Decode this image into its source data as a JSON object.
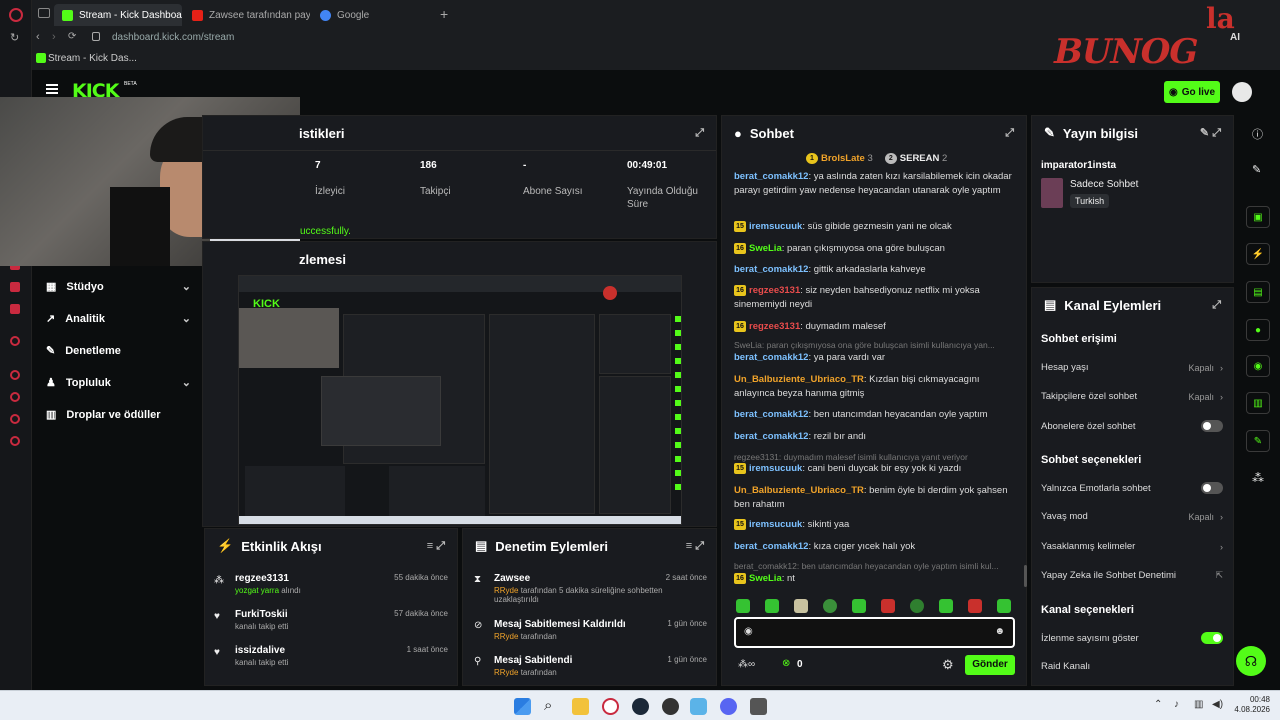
{
  "browser": {
    "tabs": [
      {
        "label": "Stream - Kick Dashboard"
      },
      {
        "label": "Zawsee tarafından paylaşı"
      },
      {
        "label": "Google"
      }
    ],
    "url": "dashboard.kick.com/stream",
    "bookmark": "Stream - Kick Das...",
    "ai_label": "AI"
  },
  "overlay": {
    "brand": "BUNOG",
    "brand_suffix": "la"
  },
  "header": {
    "logo": "KICK",
    "logo_sup": "BETA",
    "go_live": "Go live"
  },
  "stats": {
    "title": "istikleri",
    "items": [
      {
        "value": "7",
        "label": "İzleyici"
      },
      {
        "value": "186",
        "label": "Takipçi"
      },
      {
        "value": "-",
        "label": "Abone Sayısı"
      },
      {
        "value": "00:49:01",
        "label": "Yayında Olduğu Süre"
      }
    ],
    "notice": "uccessfully."
  },
  "preview": {
    "title": "zlemesi"
  },
  "sidebar": {
    "items": [
      {
        "label": "Stüdyo"
      },
      {
        "label": "Analitik"
      },
      {
        "label": "Denetleme"
      },
      {
        "label": "Topluluk"
      },
      {
        "label": "Droplar ve ödüller"
      }
    ]
  },
  "activity": {
    "title": "Etkinlik Akışı",
    "rows": [
      {
        "name": "regzee3131",
        "sub": "yozgat yarra",
        "sub2": "alındı",
        "time": "55 dakika önce"
      },
      {
        "name": "FurkiToskii",
        "sub": "kanalı takip etti",
        "sub2": "",
        "time": "57 dakika önce"
      },
      {
        "name": "issizdalive",
        "sub": "kanalı takip etti",
        "sub2": "",
        "time": "1 saat önce"
      }
    ]
  },
  "moderation": {
    "title": "Denetim Eylemleri",
    "rows": [
      {
        "name": "Zawsee",
        "by": "RRyde",
        "sub": "tarafından 5 dakika süreliğine sohbetten uzaklaştırıldı",
        "time": "2 saat önce"
      },
      {
        "name": "Mesaj Sabitlemesi Kaldırıldı",
        "by": "RRyde",
        "sub": "tarafından",
        "time": "1 gün önce"
      },
      {
        "name": "Mesaj Sabitlendi",
        "by": "RRyde",
        "sub": "tarafından",
        "time": "1 gün önce"
      }
    ]
  },
  "chat": {
    "title": "Sohbet",
    "leaders": [
      {
        "name": "BrolsLate",
        "count": "3",
        "rank": "1"
      },
      {
        "name": "SEREAN",
        "count": "2",
        "rank": "2"
      }
    ],
    "messages": [
      {
        "badge": "",
        "user": "berat_comakk12",
        "color": "l",
        "text": ": ya aslında zaten kızı karsilabilemek icin okadar parayı getirdim yaw nedense heyacandan utanarak oyle yaptım"
      },
      {
        "badge": "15",
        "user": "iremsucuuk",
        "color": "l",
        "text": ": süs gibide gezmesin yani ne olcak"
      },
      {
        "badge": "16",
        "user": "SweLia",
        "color": "g",
        "text": ": paran çıkışmıyosa ona göre buluşcan"
      },
      {
        "badge": "",
        "user": "berat_comakk12",
        "color": "l",
        "text": ": gittik arkadaslarla kahveye"
      },
      {
        "badge": "16",
        "user": "regzee3131",
        "color": "r",
        "text": ": siz neyden bahsediyonuz netflix mi yoksa sinememiydi neydi"
      },
      {
        "badge": "16",
        "user": "regzee3131",
        "color": "r",
        "text": ": duymadım malesef"
      },
      {
        "badge": "",
        "user": "",
        "color": "f",
        "text": "SweLia: paran çıkışmıyosa ona göre buluşcan isimli kullanıcıya yan..."
      },
      {
        "badge": "",
        "user": "berat_comakk12",
        "color": "l",
        "text": ": ya para vardı var"
      },
      {
        "badge": "",
        "user": "Un_Balbuziente_Ubriaco_TR",
        "color": "o",
        "text": ": Kızdan bişi cıkmayacagını anlayınca beyza hanıma gitmiş"
      },
      {
        "badge": "",
        "user": "berat_comakk12",
        "color": "l",
        "text": ": ben utancımdan heyacandan oyle yaptım"
      },
      {
        "badge": "",
        "user": "berat_comakk12",
        "color": "l",
        "text": ": rezil bır andı"
      },
      {
        "badge": "",
        "user": "",
        "color": "f",
        "text": "regzee3131: duymadım malesef isimli kullanıcıya yanıt veriyor"
      },
      {
        "badge": "15",
        "user": "iremsucuuk",
        "color": "l",
        "text": ": cani beni duycak bir eşy yok ki yazdı"
      },
      {
        "badge": "",
        "user": "Un_Balbuziente_Ubriaco_TR",
        "color": "o",
        "text": ": benim öyle bi derdim yok şahsen ben rahatım"
      },
      {
        "badge": "15",
        "user": "iremsucuuk",
        "color": "l",
        "text": ": sikinti yaa"
      },
      {
        "badge": "",
        "user": "berat_comakk12",
        "color": "l",
        "text": ": kıza cıger yıcek halı yok"
      },
      {
        "badge": "",
        "user": "",
        "color": "f",
        "text": "berat_comakk12: ben utancımdan heyacandan oyle yaptım isimli kul..."
      },
      {
        "badge": "16",
        "user": "SweLia",
        "color": "g",
        "text": ": nt"
      }
    ],
    "input_placeholder": "",
    "points": "0",
    "send": "Gönder"
  },
  "stream_info": {
    "title": "Yayın bilgisi",
    "stream_title": "imparator1insta",
    "category": "Sadece Sohbet",
    "tag": "Turkish"
  },
  "channel_actions": {
    "title": "Kanal Eylemleri",
    "chat_access": "Sohbet erişimi",
    "access_rows": [
      {
        "label": "Hesap yaşı",
        "value": "Kapalı",
        "kind": "chev"
      },
      {
        "label": "Takipçilere özel sohbet",
        "value": "Kapalı",
        "kind": "chev"
      },
      {
        "label": "Abonelere özel sohbet",
        "value": "",
        "kind": "toggle_off"
      }
    ],
    "chat_options": "Sohbet seçenekleri",
    "option_rows": [
      {
        "label": "Yalnızca Emotlarla sohbet",
        "value": "",
        "kind": "toggle_off"
      },
      {
        "label": "Yavaş mod",
        "value": "Kapalı",
        "kind": "chev"
      },
      {
        "label": "Yasaklanmış kelimeler",
        "value": "",
        "kind": "chev"
      },
      {
        "label": "Yapay Zeka ile Sohbet Denetimi",
        "value": "",
        "kind": "ext"
      }
    ],
    "channel_options": "Kanal seçenekleri",
    "channel_rows": [
      {
        "label": "İzlenme sayısını göster",
        "value": "",
        "kind": "toggle_on"
      },
      {
        "label": "Raid Kanalı",
        "value": "",
        "kind": "none"
      }
    ]
  },
  "taskbar": {
    "time": "00:48",
    "date": "4.08.2026"
  },
  "colors": {
    "accent": "#53fc18",
    "panel": "#191b1f",
    "bg": "#0b0d0e"
  }
}
